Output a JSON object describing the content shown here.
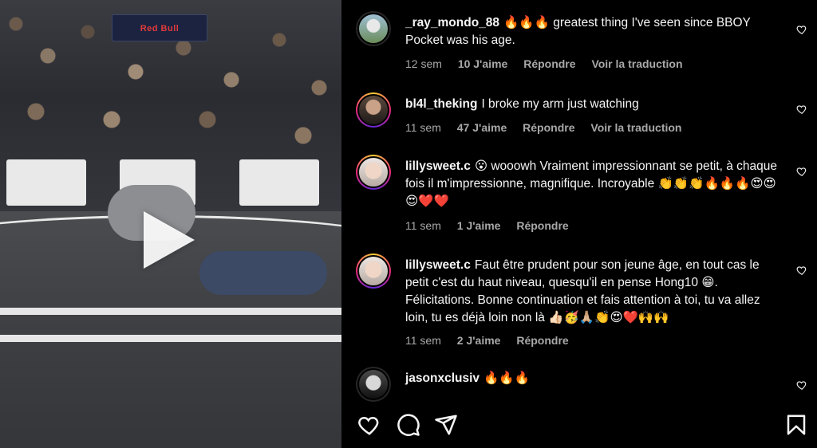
{
  "video": {
    "banner_text": "Red Bull",
    "play_icon": "play-icon"
  },
  "comments": [
    {
      "username": "_ray_mondo_88",
      "text": "🔥🔥🔥 greatest thing I've seen since BBOY Pocket was his age.",
      "time": "12 sem",
      "likes": "10 J'aime",
      "reply": "Répondre",
      "translate": "Voir la traduction"
    },
    {
      "username": "bl4l_theking",
      "text": "I broke my arm just watching",
      "time": "11 sem",
      "likes": "47 J'aime",
      "reply": "Répondre",
      "translate": "Voir la traduction"
    },
    {
      "username": "lillysweet.c",
      "text": "😮 wooowh Vraiment impressionnant se petit, à chaque fois il m'impressionne, magnifique. Incroyable 👏👏👏🔥🔥🔥😍😍😍❤️❤️",
      "time": "11 sem",
      "likes": "1 J'aime",
      "reply": "Répondre"
    },
    {
      "username": "lillysweet.c",
      "text": "Faut être prudent pour son jeune âge, en tout cas le petit c'est du haut niveau, quesqu'il en pense Hong10 😁. Félicitations. Bonne continuation et fais attention à toi, tu va allez loin, tu es déjà loin non là 👍🏻🥳🙏🏼👏😍❤️🙌🙌",
      "time": "11 sem",
      "likes": "2 J'aime",
      "reply": "Répondre"
    },
    {
      "username": "jasonxclusiv",
      "text": "🔥🔥🔥"
    }
  ],
  "actions": {
    "like_icon": "heart-icon",
    "comment_icon": "comment-icon",
    "share_icon": "share-icon",
    "save_icon": "bookmark-icon"
  }
}
